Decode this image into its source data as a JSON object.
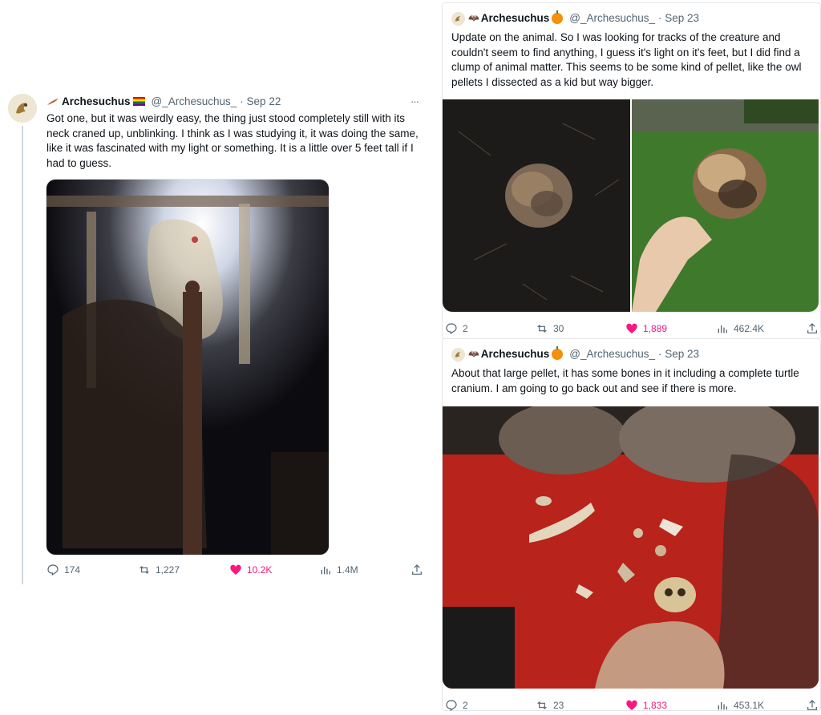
{
  "tweet1": {
    "author_name": "Archesuchus",
    "handle": "@_Archesuchus_",
    "date": "· Sep 22",
    "more": "···",
    "text": "Got one, but it was weirdly easy, the thing just stood completely still with its neck craned up, unblinking. I think as I was studying it, it was doing the same, like it was fascinated with my light or something. It is a little over 5 feet tall if I had to guess.",
    "stats": {
      "replies": "174",
      "retweets": "1,227",
      "likes": "10.2K",
      "views": "1.4M"
    }
  },
  "tweet2": {
    "author_name": "Archesuchus",
    "handle": "@_Archesuchus_",
    "date": "· Sep 23",
    "text": "Update on the animal. So I was looking for tracks of the creature and couldn't seem to find anything, I guess it's light on it's feet, but I did find a clump of animal matter. This seems to be some kind of pellet, like the owl pellets I dissected as a kid but way bigger.",
    "stats": {
      "replies": "2",
      "retweets": "30",
      "likes": "1,889",
      "views": "462.4K"
    }
  },
  "tweet3": {
    "author_name": "Archesuchus",
    "handle": "@_Archesuchus_",
    "date": "· Sep 23",
    "text": "About that large pellet, it has some bones in it including a complete turtle cranium. I am going to go back out and see if there is more.",
    "stats": {
      "replies": "2",
      "retweets": "23",
      "likes": "1,833",
      "views": "453.1K"
    }
  },
  "icons": {
    "reply": "reply-icon",
    "retweet": "retweet-icon",
    "like": "heart-icon",
    "views": "views-icon",
    "share": "share-icon"
  },
  "colors": {
    "like": "#f91880",
    "muted": "#536471",
    "text": "#0f1419",
    "border": "#e3e6e9"
  }
}
